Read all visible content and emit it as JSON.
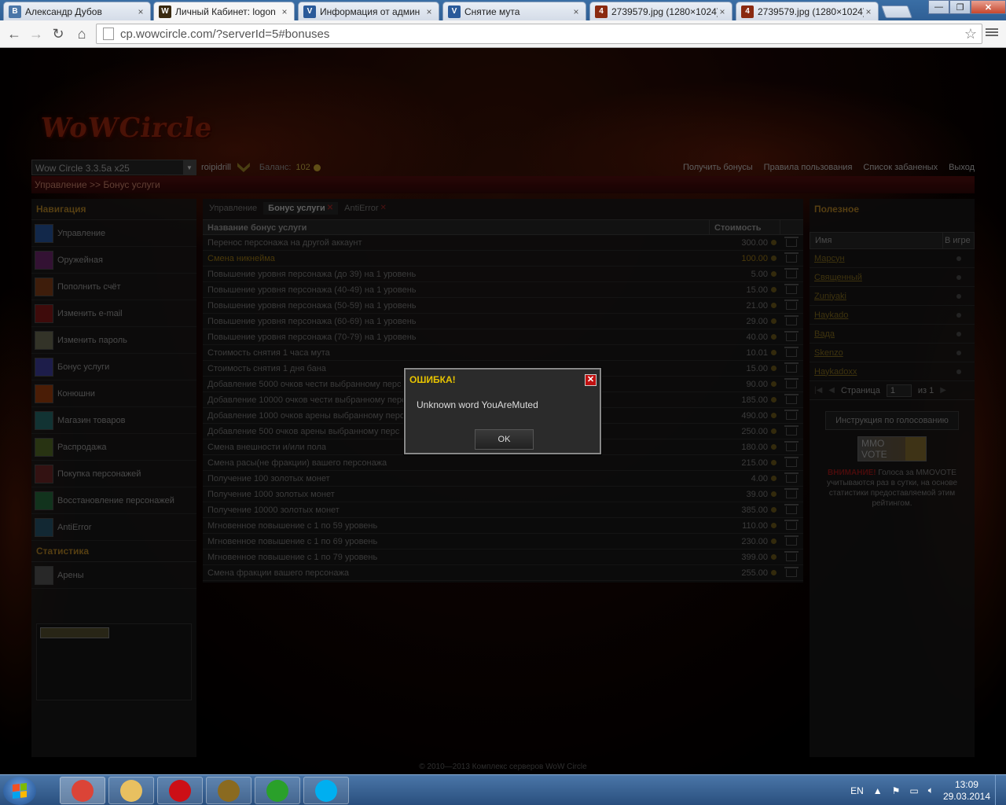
{
  "browser": {
    "tabs": [
      {
        "title": "Александр Дубов",
        "icon": "vk-icon",
        "active": false
      },
      {
        "title": "Личный Кабинет: logon",
        "icon": "wow-icon",
        "active": true
      },
      {
        "title": "Информация от админ",
        "icon": "forum-icon",
        "active": false
      },
      {
        "title": "Снятие мута",
        "icon": "forum-icon",
        "active": false
      },
      {
        "title": "2739579.jpg (1280×1024)",
        "icon": "image-icon",
        "active": false
      },
      {
        "title": "2739579.jpg (1280×1024)",
        "icon": "image-icon",
        "active": false
      }
    ],
    "url": "cp.wowcircle.com/?serverId=5#bonuses"
  },
  "site": {
    "logo": "WoWCircle",
    "server": "Wow Circle 3.3.5a x25",
    "username": "roipidrill",
    "balance_label": "Баланс:",
    "balance_value": "102",
    "top_links": [
      "Получить бонусы",
      "Правила пользования",
      "Список забаненых",
      "Выход"
    ],
    "breadcrumb": "Управление >> Бонус услуги",
    "footer": "© 2010—2013 Комплекс серверов WoW Circle"
  },
  "nav": {
    "heading": "Навигация",
    "items": [
      {
        "label": "Управление",
        "icon": "management-icon",
        "color": "#1a3a6a"
      },
      {
        "label": "Оружейная",
        "icon": "armory-icon",
        "color": "#4a1a4a"
      },
      {
        "label": "Пополнить счёт",
        "icon": "payment-icon",
        "color": "#5a2a10"
      },
      {
        "label": "Изменить e-mail",
        "icon": "email-icon",
        "color": "#5a1010"
      },
      {
        "label": "Изменить пароль",
        "icon": "password-icon",
        "color": "#4a4a3a"
      },
      {
        "label": "Бонус услуги",
        "icon": "bonus-icon",
        "color": "#2a2a6a"
      },
      {
        "label": "Конюшни",
        "icon": "stable-icon",
        "color": "#6a2a0a"
      },
      {
        "label": "Магазин товаров",
        "icon": "shop-icon",
        "color": "#1a4a4a"
      },
      {
        "label": "Распродажа",
        "icon": "sale-icon",
        "color": "#3a4a1a"
      },
      {
        "label": "Покупка персонажей",
        "icon": "buy-character-icon",
        "color": "#4a1a1a"
      },
      {
        "label": "Восстановление персонажей",
        "icon": "restore-character-icon",
        "color": "#1a4a2a"
      },
      {
        "label": "AntiError",
        "icon": "antierror-icon",
        "color": "#1a3a4a"
      }
    ],
    "stats_heading": "Статистика",
    "stats_items": [
      {
        "label": "Арены",
        "icon": "arena-icon",
        "color": "#3a3a3a"
      }
    ]
  },
  "content": {
    "tabs": [
      {
        "label": "Управление",
        "closable": false,
        "active": false
      },
      {
        "label": "Бонус услуги",
        "closable": true,
        "active": true
      },
      {
        "label": "AntiError",
        "closable": true,
        "active": false
      }
    ],
    "columns": [
      "Название бонус услуги",
      "Стоимость"
    ],
    "rows": [
      {
        "name": "Перенос персонажа на другой аккаунт",
        "price": "300.00"
      },
      {
        "name": "Смена никнейма",
        "price": "100.00",
        "highlight": true
      },
      {
        "name": "Повышение уровня персонажа (до 39) на 1 уровень",
        "price": "5.00"
      },
      {
        "name": "Повышение уровня персонажа (40-49) на 1 уровень",
        "price": "15.00"
      },
      {
        "name": "Повышение уровня персонажа (50-59) на 1 уровень",
        "price": "21.00"
      },
      {
        "name": "Повышение уровня персонажа (60-69) на 1 уровень",
        "price": "29.00"
      },
      {
        "name": "Повышение уровня персонажа (70-79) на 1 уровень",
        "price": "40.00"
      },
      {
        "name": "Стоимость снятия 1 часа мута",
        "price": "10.01"
      },
      {
        "name": "Стоимость снятия 1 дня бана",
        "price": "15.00"
      },
      {
        "name": "Добавление 5000 очков чести выбранному перс",
        "price": "90.00"
      },
      {
        "name": "Добавление 10000 очков чести выбранному перс",
        "price": "185.00"
      },
      {
        "name": "Добавление 1000 очков арены выбранному перс",
        "price": "490.00"
      },
      {
        "name": "Добавление 500 очков арены выбранному перс",
        "price": "250.00"
      },
      {
        "name": "Смена внешности и/или пола",
        "price": "180.00"
      },
      {
        "name": "Смена расы(не фракции) вашего персонажа",
        "price": "215.00"
      },
      {
        "name": "Получение 100 золотых монет",
        "price": "4.00"
      },
      {
        "name": "Получение 1000 золотых монет",
        "price": "39.00"
      },
      {
        "name": "Получение 10000 золотых монет",
        "price": "385.00"
      },
      {
        "name": "Мгновенное повышение с 1 по 59 уровень",
        "price": "110.00"
      },
      {
        "name": "Мгновенное повышение с 1 по 69 уровень",
        "price": "230.00"
      },
      {
        "name": "Мгновенное повышение с 1 по 79 уровень",
        "price": "399.00"
      },
      {
        "name": "Смена фракции вашего персонажа",
        "price": "255.00"
      }
    ]
  },
  "useful": {
    "heading": "Полезное",
    "columns": [
      "Имя",
      "В игре"
    ],
    "players": [
      "Марсун",
      "Священный",
      "Zuniyaki",
      "Haykado",
      "Вада",
      "Skenzo",
      "Haykadoxx"
    ],
    "pager": {
      "label": "Страница",
      "page": "1",
      "of": "из 1"
    },
    "vote_button": "Инструкция по голосованию",
    "vote_banner": "MMO VOTE",
    "vote_warning": "ВНИМАНИЕ!",
    "vote_note": "Голоса за MMOVOTE учитываются раз в сутки, на основе статистики предоставляемой этим рейтингом."
  },
  "dialog": {
    "title": "ОШИБКА!",
    "message": "Unknown word YouAreMuted",
    "ok_label": "OK"
  },
  "taskbar": {
    "apps": [
      {
        "name": "chrome-icon",
        "color": "#db4437"
      },
      {
        "name": "explorer-icon",
        "color": "#e8c060"
      },
      {
        "name": "opera-icon",
        "color": "#cc0f16"
      },
      {
        "name": "wow-icon",
        "color": "#8a6a20"
      },
      {
        "name": "app-a-icon",
        "color": "#2aa02a"
      },
      {
        "name": "skype-icon",
        "color": "#00aff0"
      }
    ],
    "lang": "EN",
    "time": "13:09",
    "date": "29.03.2014"
  }
}
